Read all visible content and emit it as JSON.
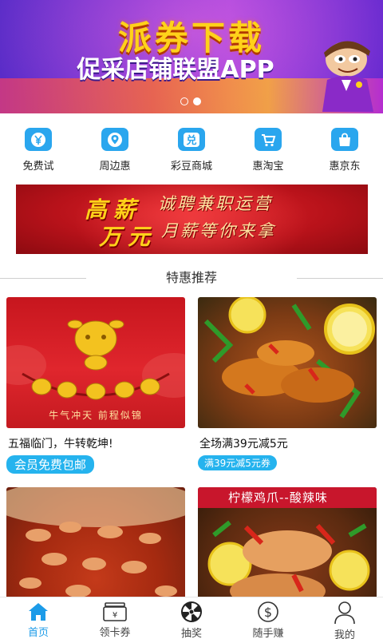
{
  "banner": {
    "headline": "派券下载",
    "subline": "促采店铺联盟APP",
    "slides_total": 2,
    "slide_active": 2
  },
  "quick_nav": [
    {
      "label": "免费试",
      "icon": "yen-icon"
    },
    {
      "label": "周边惠",
      "icon": "location-icon"
    },
    {
      "label": "彩豆商城",
      "icon": "exchange-icon"
    },
    {
      "label": "惠淘宝",
      "icon": "cart-icon"
    },
    {
      "label": "惠京东",
      "icon": "bag-icon"
    }
  ],
  "recruit_banner": {
    "big_top": "高薪",
    "big_bottom": "万元",
    "line1": "诚聘兼职运营",
    "line2": "月薪等你来拿"
  },
  "section": {
    "title": "特惠推荐"
  },
  "products": [
    {
      "title": "五福临门，牛转乾坤!",
      "tag": "会员免费包邮",
      "image_caption": "牛气冲天  前程似锦"
    },
    {
      "title": "全场满39元减5元",
      "tag": "满39元减5元券"
    },
    {
      "title": "",
      "tag": ""
    },
    {
      "title": "",
      "tag": "",
      "image_caption": "柠檬鸡爪--酸辣味"
    }
  ],
  "tabs": [
    {
      "label": "首页",
      "icon": "home-icon",
      "active": true
    },
    {
      "label": "领卡券",
      "icon": "card-coupon-icon",
      "active": false
    },
    {
      "label": "抽奖",
      "icon": "lottery-wheel-icon",
      "active": false
    },
    {
      "label": "随手赚",
      "icon": "dollar-icon",
      "active": false
    },
    {
      "label": "我的",
      "icon": "user-icon",
      "active": false
    }
  ],
  "colors": {
    "accent": "#25b3ee",
    "tab_active": "#1c9be8",
    "banner_purple": "#7a33d6",
    "recruit_red": "#c41a20"
  }
}
